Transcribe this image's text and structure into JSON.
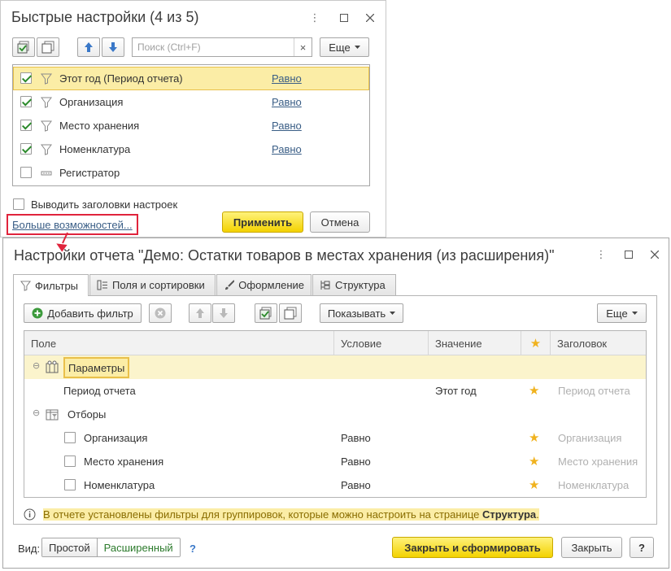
{
  "quick": {
    "title": "Быстрые настройки (4 из 5)",
    "search_placeholder": "Поиск (Ctrl+F)",
    "search_clear": "×",
    "more_label": "Еще",
    "rows": [
      {
        "label": "Этот год (Период отчета)",
        "cond": "Равно",
        "checked": true,
        "selected": true
      },
      {
        "label": "Организация",
        "cond": "Равно",
        "checked": true
      },
      {
        "label": "Место хранения",
        "cond": "Равно",
        "checked": true
      },
      {
        "label": "Номенклатура",
        "cond": "Равно",
        "checked": true
      },
      {
        "label": "Регистратор",
        "cond": "",
        "checked": false
      }
    ],
    "show_headers_label": "Выводить заголовки настроек",
    "more_options_link": "Больше возможностей...",
    "apply_label": "Применить",
    "cancel_label": "Отмена"
  },
  "settings": {
    "title": "Настройки отчета \"Демо: Остатки товаров в местах хранения (из расширения)\"",
    "tabs": [
      {
        "label": "Фильтры",
        "icon": "funnel-icon",
        "active": true
      },
      {
        "label": "Поля и сортировки",
        "icon": "fields-icon"
      },
      {
        "label": "Оформление",
        "icon": "brush-icon"
      },
      {
        "label": "Структура",
        "icon": "structure-icon"
      }
    ],
    "toolbar": {
      "add_filter": "Добавить фильтр",
      "show_label": "Показывать",
      "more_label": "Еще"
    },
    "columns": [
      "Поле",
      "Условие",
      "Значение",
      "★",
      "Заголовок"
    ],
    "group_params": "Параметры",
    "period_row": {
      "field": "Период отчета",
      "value": "Этот год",
      "title": "Период отчета"
    },
    "group_filters": "Отборы",
    "filter_rows": [
      {
        "field": "Организация",
        "cond": "Равно",
        "title": "Организация"
      },
      {
        "field": "Место хранения",
        "cond": "Равно",
        "title": "Место хранения"
      },
      {
        "field": "Номенклатура",
        "cond": "Равно",
        "title": "Номенклатура"
      }
    ],
    "info_text": "В отчете установлены фильтры для группировок, которые можно настроить на странице ",
    "info_link": "Структура",
    "info_end": ".",
    "view_label": "Вид:",
    "view_simple": "Простой",
    "view_extended": "Расширенный",
    "help": "?",
    "close_and_build": "Закрыть и сформировать",
    "close": "Закрыть",
    "help_button": "?"
  }
}
